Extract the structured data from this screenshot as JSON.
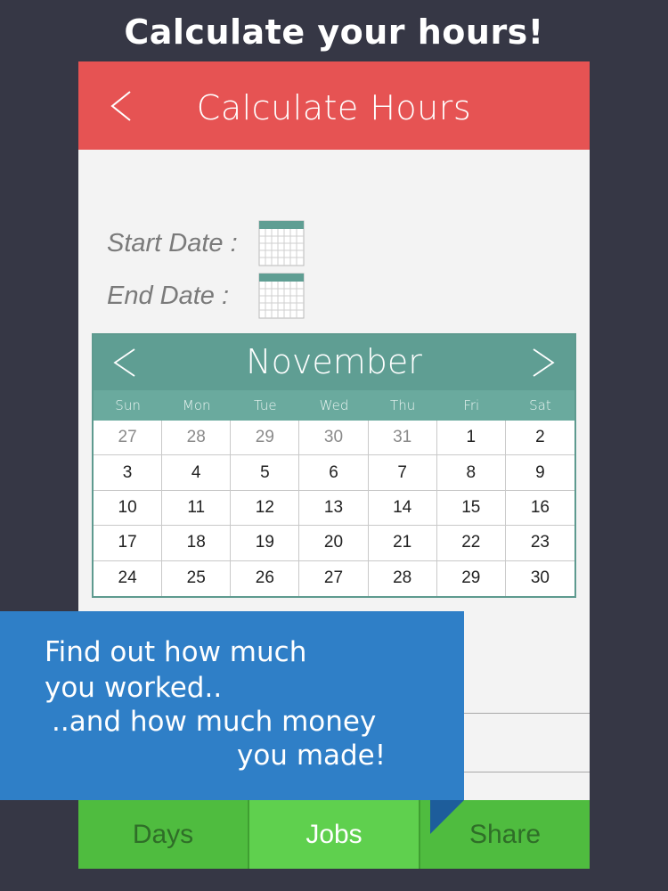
{
  "promo": {
    "title": "Calculate your hours!"
  },
  "header": {
    "title": "Calculate Hours"
  },
  "form": {
    "start_label": "Start Date :",
    "end_label": "End Date :"
  },
  "calendar": {
    "month": "November",
    "weekdays": [
      "Sun",
      "Mon",
      "Tue",
      "Wed",
      "Thu",
      "Fri",
      "Sat"
    ],
    "days": [
      [
        "27",
        "28",
        "29",
        "30",
        "31",
        "1",
        "2"
      ],
      [
        "3",
        "4",
        "5",
        "6",
        "7",
        "8",
        "9"
      ],
      [
        "10",
        "11",
        "12",
        "13",
        "14",
        "15",
        "16"
      ],
      [
        "17",
        "18",
        "19",
        "20",
        "21",
        "22",
        "23"
      ],
      [
        "24",
        "25",
        "26",
        "27",
        "28",
        "29",
        "30"
      ]
    ],
    "muted_days_first_row": 5
  },
  "banner": {
    "line1": "Find out how much",
    "line2": "you worked..",
    "line3": "..and how much money",
    "line4": "you made!"
  },
  "tabs": {
    "days": "Days",
    "jobs": "Jobs",
    "share": "Share",
    "active": "jobs"
  },
  "colors": {
    "background": "#363745",
    "header": "#e65353",
    "calendar_teal": "#5f9e93",
    "tab_green": "#4fbc3f",
    "banner_blue": "#2f7fc7"
  },
  "icons": [
    "back-arrow-icon",
    "calendar-icon",
    "chevron-left-icon",
    "chevron-right-icon"
  ]
}
